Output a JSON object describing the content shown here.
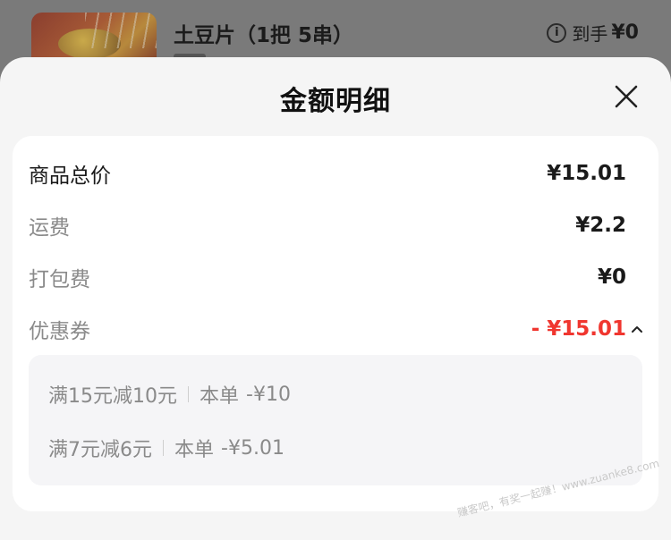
{
  "background": {
    "product_title": "土豆片（1把 5串）",
    "info_label": "到手",
    "info_price": "¥0"
  },
  "sheet": {
    "title": "金额明细"
  },
  "rows": {
    "total_label": "商品总价",
    "total_value": "¥15.01",
    "shipping_label": "运费",
    "shipping_value": "¥2.2",
    "packing_label": "打包费",
    "packing_value": "¥0",
    "coupon_label": "优惠券",
    "coupon_value": "- ¥15.01"
  },
  "coupons": [
    {
      "rule": "满15元减10元",
      "scope": "本单",
      "amount": "-¥10"
    },
    {
      "rule": "满7元减6元",
      "scope": "本单",
      "amount": "-¥5.01"
    }
  ],
  "watermark": "赚客吧，有奖一起赚！www.zuanke8.com",
  "colors": {
    "accent_red": "#f0362f"
  }
}
